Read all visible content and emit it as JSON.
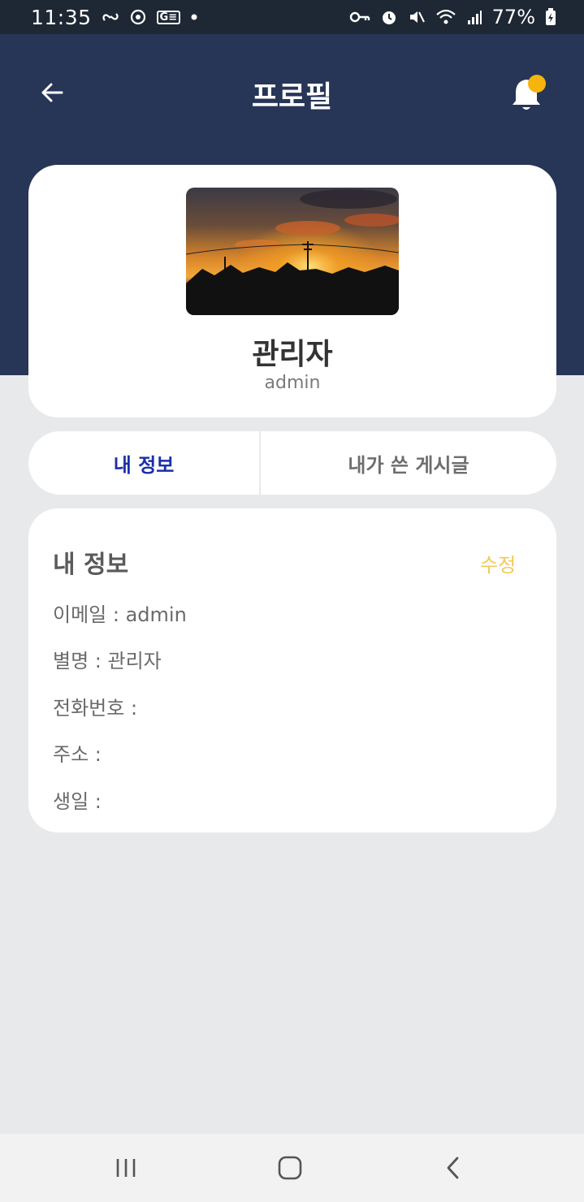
{
  "status_bar": {
    "time": "11:35",
    "battery": "77%",
    "icons": [
      "link-icon",
      "sync-icon",
      "g-icon",
      "dot-icon",
      "key-icon",
      "alarm-icon",
      "mute-icon",
      "wifi-icon",
      "signal-icon",
      "battery-icon"
    ]
  },
  "header": {
    "title": "프로필",
    "notification_dot_color": "#f5b50c"
  },
  "profile": {
    "name": "관리자",
    "username": "admin"
  },
  "tabs": [
    {
      "label": "내 정보",
      "active": true
    },
    {
      "label": "내가 쓴 게시글",
      "active": false
    }
  ],
  "info": {
    "title": "내 정보",
    "edit_label": "수정",
    "rows": [
      "이메일 : admin",
      "별명 : 관리자",
      "전화번호 :",
      "주소 :",
      "생일 :"
    ]
  },
  "colors": {
    "header_bg": "#273557",
    "active_tab": "#1a2fa8",
    "edit_accent": "#f3c85a"
  }
}
